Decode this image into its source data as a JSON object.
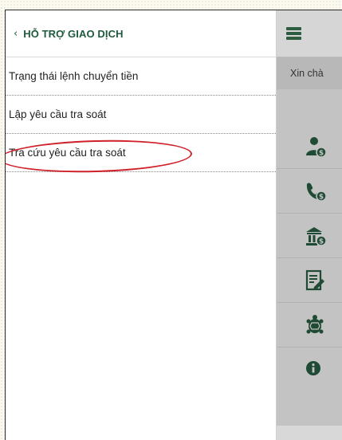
{
  "menu": {
    "back_icon": "‹",
    "title": "HỖ TRỢ GIAO DỊCH",
    "items": [
      {
        "label": "Trạng thái lệnh chuyển tiền"
      },
      {
        "label": "Lập yêu cầu tra soát"
      },
      {
        "label": "Tra cứu yêu cầu tra soát"
      }
    ]
  },
  "app": {
    "greeting": "Xin chà",
    "icons": [
      "user-money-icon",
      "phone-money-icon",
      "bank-money-icon",
      "document-edit-icon",
      "tortoise-icon",
      "info-icon"
    ]
  },
  "colors": {
    "brand_green": "#1f5a3e",
    "annotation_red": "#d0202a",
    "overlay_gray": "#c3c3c3"
  }
}
